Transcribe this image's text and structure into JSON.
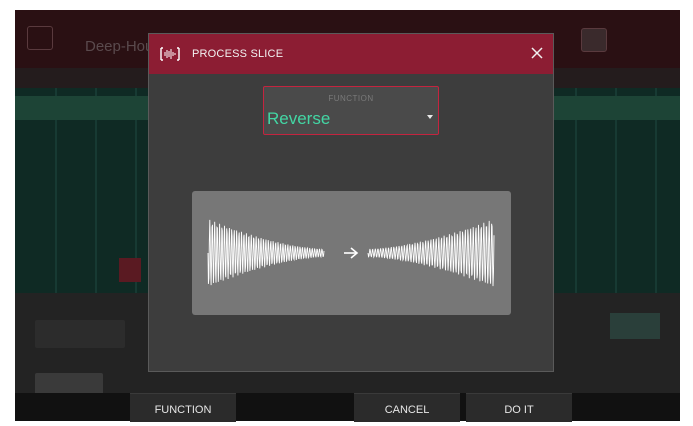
{
  "background": {
    "title": "Deep-House"
  },
  "dialog": {
    "title": "PROCESS SLICE",
    "function_label": "FUNCTION",
    "function_value": "Reverse"
  },
  "bottom_bar": {
    "function_label": "FUNCTION",
    "cancel_label": "CANCEL",
    "doit_label": "DO IT"
  },
  "colors": {
    "accent": "#8c1d33",
    "value_text": "#43d6a4"
  },
  "icons": [
    "process-slice-icon",
    "close-icon",
    "dropdown-caret-icon",
    "arrow-right-icon"
  ]
}
